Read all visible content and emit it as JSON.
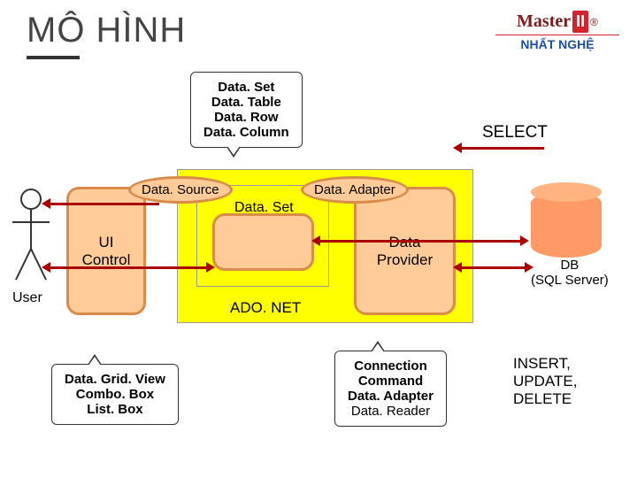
{
  "header": {
    "title": "MÔ HÌNH",
    "logo_master": "Master",
    "logo_ii": "II",
    "logo_r": "®",
    "logo_sub": "NHẤT NGHỆ"
  },
  "diagram": {
    "callout_dataset": {
      "l1": "Data. Set",
      "l2": "Data. Table",
      "l3": "Data. Row",
      "l4": "Data. Column"
    },
    "select": "SELECT",
    "datasource": "Data. Source",
    "dataadapter": "Data. Adapter",
    "ui_control": "UI\nControl",
    "dataset_label": "Data. Set",
    "data_provider": "Data\nProvider",
    "db_label": "DB\n(SQL Server)",
    "user": "User",
    "adonet": "ADO. NET",
    "callout_uicontrols": {
      "l1": "Data. Grid. View",
      "l2": "Combo. Box",
      "l3": "List. Box"
    },
    "callout_provider": {
      "l1": "Connection",
      "l2": "Command",
      "l3": "Data. Adapter",
      "l4": "Data. Reader"
    },
    "sql_ops": "INSERT,\nUPDATE,\nDELETE"
  }
}
